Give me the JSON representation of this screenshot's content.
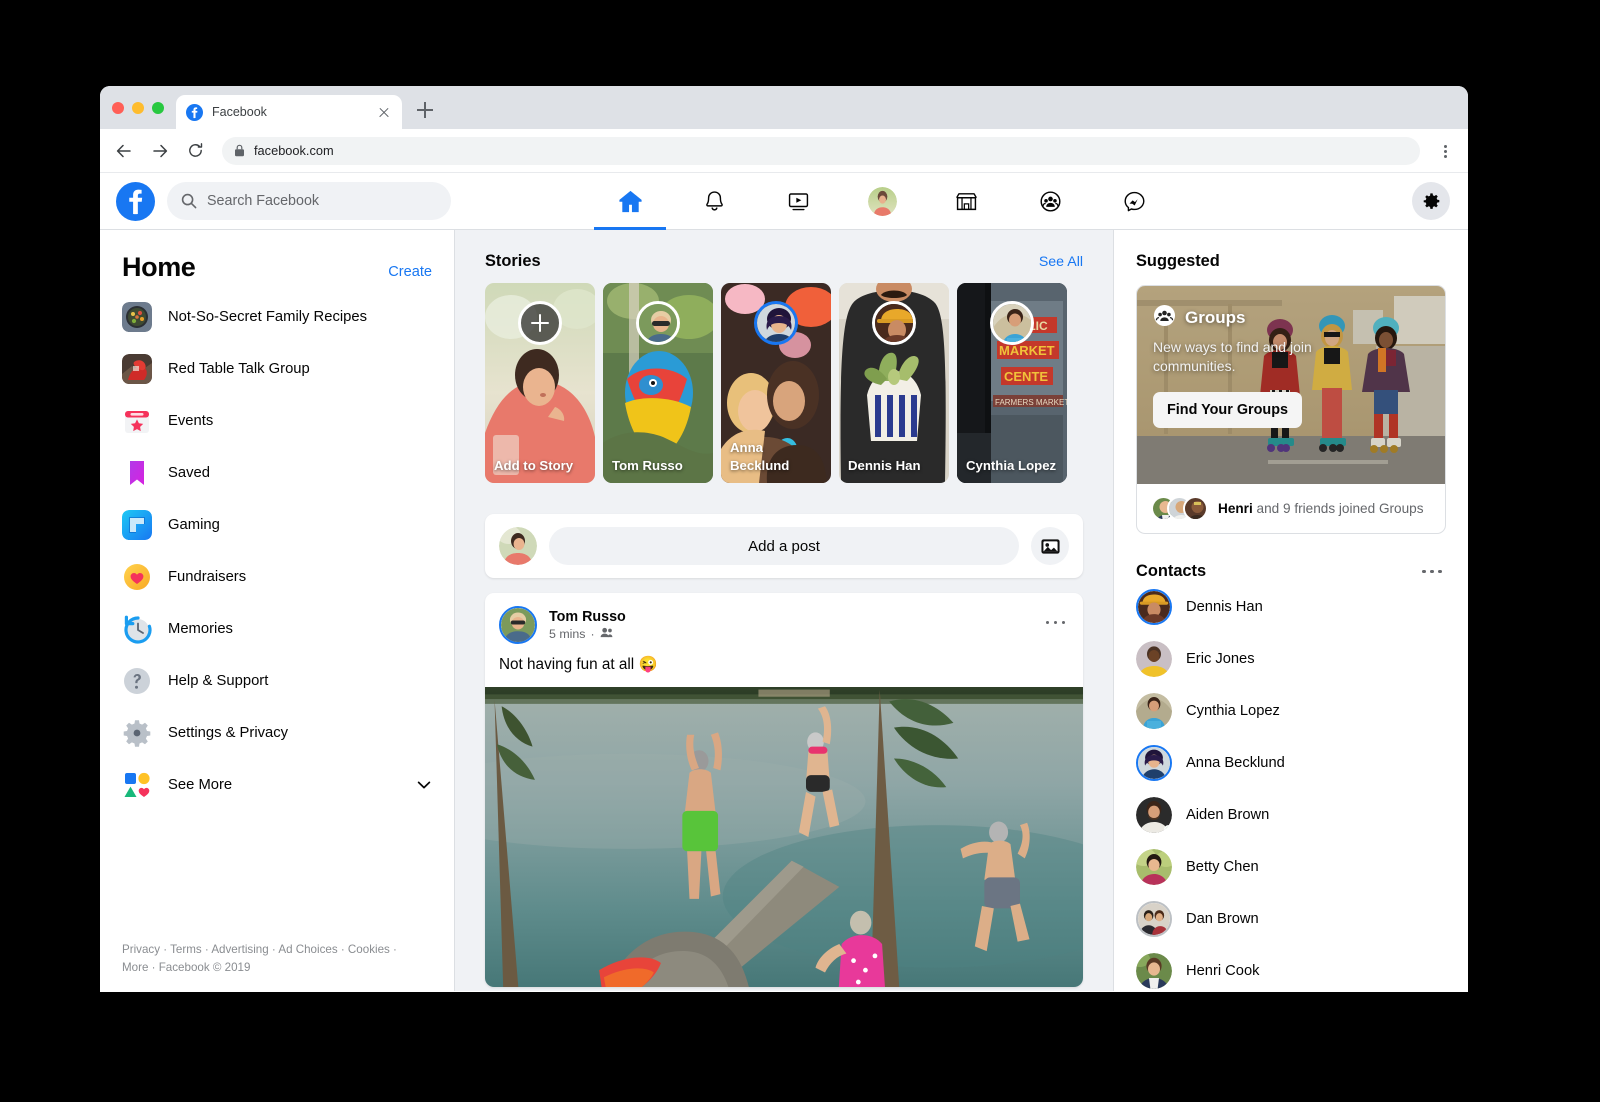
{
  "browser": {
    "tab_title": "Facebook",
    "tab_favicon": "facebook-favicon",
    "url": "facebook.com",
    "back_icon": "back-arrow-icon",
    "forward_icon": "forward-arrow-icon",
    "reload_icon": "reload-icon",
    "lock_icon": "lock-icon",
    "menu_icon": "kebab-menu-icon",
    "new_tab_icon": "plus-icon",
    "close_tab_icon": "close-icon"
  },
  "topnav": {
    "logo": "facebook-logo",
    "search_placeholder": "Search Facebook",
    "search_icon": "search-icon",
    "items": [
      {
        "name": "home",
        "icon": "home-icon",
        "active": true
      },
      {
        "name": "notifications",
        "icon": "bell-icon",
        "active": false
      },
      {
        "name": "watch",
        "icon": "video-screen-icon",
        "active": false
      },
      {
        "name": "profile",
        "icon": "profile-avatar",
        "active": false
      },
      {
        "name": "marketplace",
        "icon": "storefront-icon",
        "active": false
      },
      {
        "name": "groups",
        "icon": "groups-icon",
        "active": false
      },
      {
        "name": "messenger",
        "icon": "messenger-icon",
        "active": false
      }
    ],
    "settings_icon": "gear-icon"
  },
  "sidebar": {
    "title": "Home",
    "create_label": "Create",
    "items": [
      {
        "label": "Not-So-Secret Family Recipes",
        "icon": "group-photo-recipes"
      },
      {
        "label": "Red Table Talk Group",
        "icon": "group-photo-red-table"
      },
      {
        "label": "Events",
        "icon": "calendar-star-icon"
      },
      {
        "label": "Saved",
        "icon": "bookmark-icon"
      },
      {
        "label": "Gaming",
        "icon": "gaming-icon"
      },
      {
        "label": "Fundraisers",
        "icon": "heart-icon"
      },
      {
        "label": "Memories",
        "icon": "clock-history-icon"
      },
      {
        "label": "Help & Support",
        "icon": "question-mark-icon"
      },
      {
        "label": "Settings & Privacy",
        "icon": "gear-icon"
      },
      {
        "label": "See More",
        "icon": "shapes-icon",
        "chevron": "chevron-down-icon"
      }
    ],
    "footer_line1": "Privacy · Terms · Advertising · Ad Choices · Cookies ·",
    "footer_line2": "More · Facebook © 2019"
  },
  "stories": {
    "heading": "Stories",
    "see_all_label": "See All",
    "items": [
      {
        "name": "Add to Story",
        "type": "add",
        "badge": "plus-icon",
        "bg": "photo-woman-pink-shirt"
      },
      {
        "name": "Tom Russo",
        "type": "story",
        "badge": "avatar-tom-russo",
        "bg": "photo-pinata"
      },
      {
        "name": "Anna Becklund",
        "type": "story",
        "badge": "avatar-anna-becklund",
        "bg": "photo-two-women"
      },
      {
        "name": "Dennis Han",
        "type": "story",
        "badge": "avatar-dennis-han",
        "bg": "photo-man-plant"
      },
      {
        "name": "Cynthia Lopez",
        "type": "story",
        "badge": "avatar-cynthia-lopez",
        "bg": "photo-public-market"
      }
    ]
  },
  "composer": {
    "avatar": "user-avatar",
    "field_label": "Add a post",
    "photo_button_icon": "image-icon"
  },
  "post": {
    "author": "Tom Russo",
    "avatar": "avatar-tom-russo",
    "timestamp": "5 mins",
    "audience_icon": "friends-icon",
    "separator": "·",
    "menu_icon": "ellipsis-icon",
    "text": "Not having fun at all 😜",
    "photo": "photo-lake-jumping"
  },
  "suggested": {
    "heading": "Suggested",
    "card": {
      "icon": "groups-badge-icon",
      "title": "Groups",
      "subtitle": "New ways to find and join communities.",
      "button_label": "Find Your Groups",
      "image": "photo-roller-skaters",
      "footer_bold": "Henri",
      "footer_rest": " and 9 friends joined Groups",
      "facepile": [
        "avatar-henri",
        "avatar-friend-2",
        "avatar-friend-3"
      ]
    }
  },
  "contacts": {
    "heading": "Contacts",
    "menu_icon": "ellipsis-icon",
    "items": [
      {
        "name": "Dennis Han",
        "ring": "blue",
        "online": false
      },
      {
        "name": "Eric Jones",
        "ring": "none",
        "online": false
      },
      {
        "name": "Cynthia Lopez",
        "ring": "none",
        "online": false
      },
      {
        "name": "Anna Becklund",
        "ring": "blue",
        "online": false
      },
      {
        "name": "Aiden Brown",
        "ring": "none",
        "online": true
      },
      {
        "name": "Betty Chen",
        "ring": "none",
        "online": false
      },
      {
        "name": "Dan Brown",
        "ring": "grey",
        "online": false
      },
      {
        "name": "Henri Cook",
        "ring": "none",
        "online": false
      }
    ]
  },
  "colors": {
    "accent": "#1877f2",
    "page_bg": "#f0f2f5",
    "surface": "#ffffff",
    "text_primary": "#050505",
    "text_secondary": "#65676b",
    "online": "#31a24c",
    "chrome_tabstrip": "#dee1e6"
  }
}
